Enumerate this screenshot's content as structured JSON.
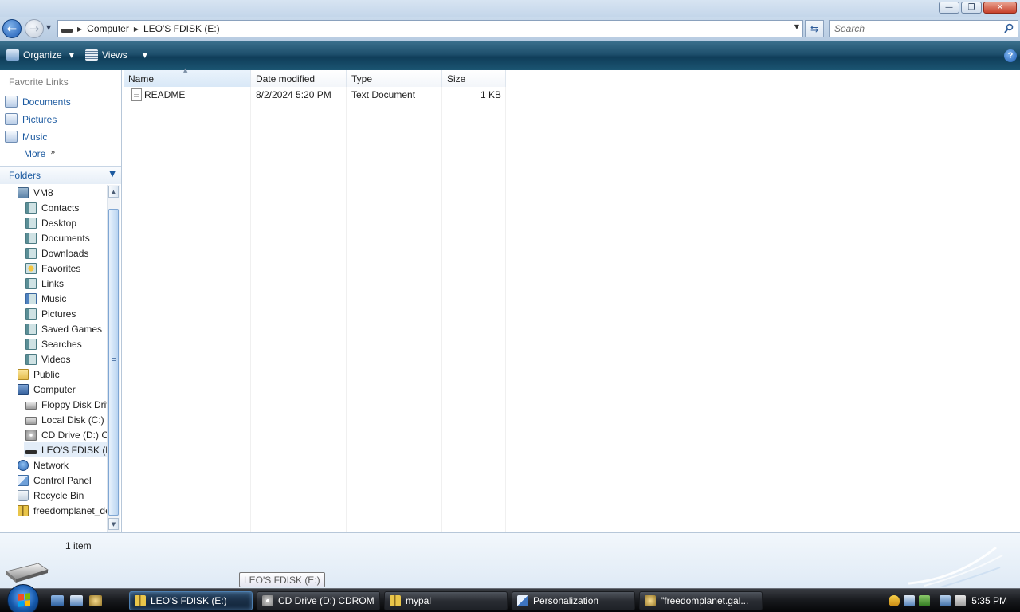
{
  "window": {
    "caption_buttons": [
      "minimize",
      "maximize",
      "close"
    ]
  },
  "address": {
    "crumbs": [
      "Computer",
      "LEO'S FDISK (E:)"
    ],
    "search_placeholder": "Search"
  },
  "toolbar": {
    "organize_label": "Organize",
    "views_label": "Views",
    "help_label": "?"
  },
  "nav": {
    "favorite_links_header": "Favorite Links",
    "favorites": [
      {
        "label": "Documents",
        "icon": "documents-icon"
      },
      {
        "label": "Pictures",
        "icon": "pictures-icon"
      },
      {
        "label": "Music",
        "icon": "music-icon"
      }
    ],
    "more_label": "More",
    "folders_header": "Folders",
    "tree": [
      {
        "label": "VM8",
        "icon": "user-folder-icon"
      },
      {
        "label": "Contacts",
        "icon": "contacts-icon"
      },
      {
        "label": "Desktop",
        "icon": "desktop-icon"
      },
      {
        "label": "Documents",
        "icon": "documents-icon"
      },
      {
        "label": "Downloads",
        "icon": "downloads-icon"
      },
      {
        "label": "Favorites",
        "icon": "favorites-icon"
      },
      {
        "label": "Links",
        "icon": "links-icon"
      },
      {
        "label": "Music",
        "icon": "music-icon"
      },
      {
        "label": "Pictures",
        "icon": "pictures-icon"
      },
      {
        "label": "Saved Games",
        "icon": "saved-games-icon"
      },
      {
        "label": "Searches",
        "icon": "searches-icon"
      },
      {
        "label": "Videos",
        "icon": "videos-icon"
      },
      {
        "label": "Public",
        "icon": "folder-icon"
      },
      {
        "label": "Computer",
        "icon": "computer-icon"
      },
      {
        "label": "Floppy Disk Drive",
        "icon": "floppy-drive-icon"
      },
      {
        "label": "Local Disk (C:)",
        "icon": "hard-disk-icon"
      },
      {
        "label": "CD Drive (D:) CDROM",
        "icon": "cd-drive-icon"
      },
      {
        "label": "LEO'S FDISK (E:)",
        "icon": "usb-drive-icon"
      },
      {
        "label": "Network",
        "icon": "network-icon"
      },
      {
        "label": "Control Panel",
        "icon": "control-panel-icon"
      },
      {
        "label": "Recycle Bin",
        "icon": "recycle-bin-icon"
      },
      {
        "label": "freedomplanet_demo",
        "icon": "zip-folder-icon"
      }
    ]
  },
  "files": {
    "columns": [
      "Name",
      "Date modified",
      "Type",
      "Size"
    ],
    "rows": [
      {
        "name": "README",
        "date": "8/2/2024 5:20 PM",
        "type": "Text Document",
        "size": "1 KB"
      }
    ]
  },
  "details": {
    "count": "1 item"
  },
  "tooltip": "LEO'S FDISK (E:)",
  "taskbar": {
    "tasks": [
      {
        "label": "LEO'S FDISK (E:)",
        "active": true
      },
      {
        "label": "CD Drive (D:) CDROM",
        "active": false
      },
      {
        "label": "mypal",
        "active": false
      },
      {
        "label": "Personalization",
        "active": false
      },
      {
        "label": "\"freedomplanet.gal...",
        "active": false
      }
    ],
    "clock": "5:35 PM"
  },
  "colors": {
    "link_blue": "#1c5aa0",
    "toolbar_teal": "#1d4f6c",
    "taskbar_black": "#17191d"
  }
}
